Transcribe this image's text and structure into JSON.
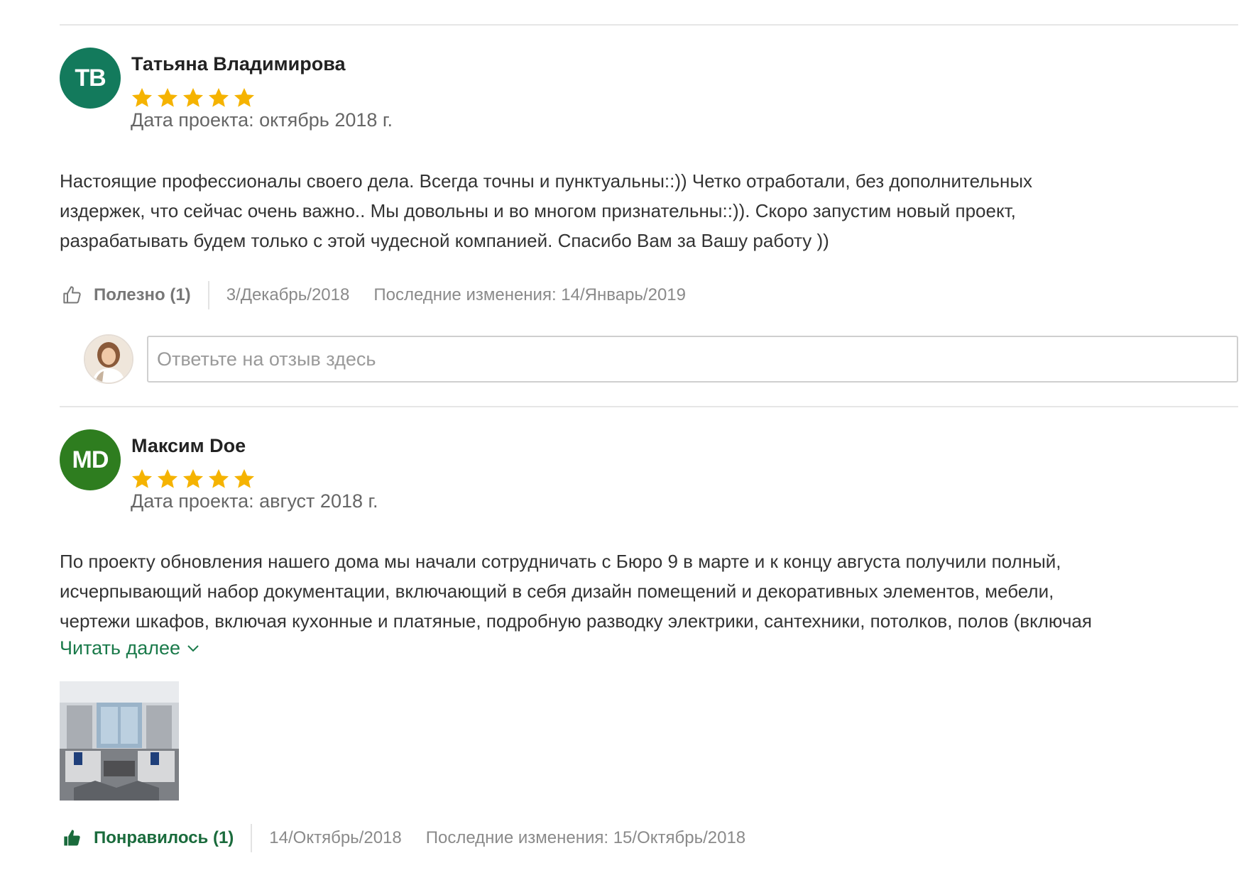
{
  "colors": {
    "accent_green": "#1a7a4a",
    "avatar_tb": "#137a5c",
    "avatar_md": "#2e7d1f",
    "star": "#f5b301"
  },
  "reviews": [
    {
      "initials": "ТВ",
      "name": "Татьяна Владимирова",
      "rating": 5,
      "project_date": "Дата проекта: октябрь 2018 г.",
      "text_lines": [
        "Настоящие профессионалы своего дела. Всегда точны  и  пунктуальны::)) Четко отработали,  без дополнительных",
        "издержек, что сейчас  очень важно.. Мы довольны и  во многом признательны::)). Скоро запустим  новый  проект,",
        "разрабатывать будем  только с  этой  чудесной  компанией.  Спасибо Вам  за  Вашу  работу ))"
      ],
      "helpful_label": "Полезно (1)",
      "date": "3/Декабрь/2018",
      "last_modified": "Последние изменения:  14/Январь/2019",
      "reply_placeholder": "Ответьте на отзыв здесь"
    },
    {
      "initials": "MD",
      "name": "Максим Doe",
      "rating": 5,
      "project_date": "Дата проекта: август 2018 г.",
      "text_lines": [
        "По проекту обновления нашего дома мы начали сотрудничать с Бюро 9 в марте и к концу августа получили полный,",
        "исчерпывающий набор документации, включающий в себя дизайн помещений и декоративных элементов, мебели,",
        "чертежи шкафов, включая кухонные и платяные, подробную разводку электрики, сантехники, потолков, полов (включая"
      ],
      "read_more": "Читать далее",
      "helpful_label": "Понравилось (1)",
      "date": "14/Октябрь/2018",
      "last_modified": "Последние изменения:  15/Октябрь/2018"
    }
  ]
}
